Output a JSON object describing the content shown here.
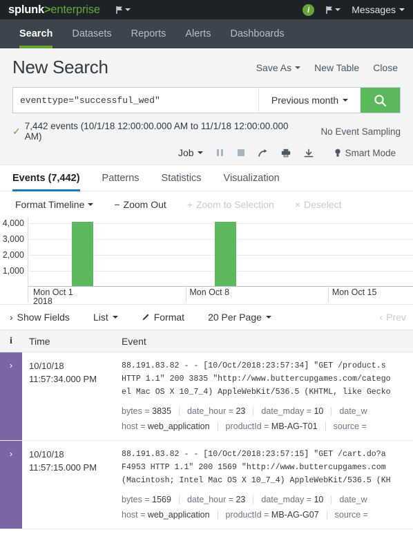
{
  "topbar": {
    "logo_splunk": "splunk",
    "logo_gt": ">",
    "logo_enterprise": "enterprise",
    "flag_icon": "flag-icon",
    "info_icon": "info-circle-icon",
    "info_label": "i",
    "messages_label": "Messages",
    "bg_color": "#1c2226",
    "accent_color": "#65a637"
  },
  "nav": {
    "items": [
      {
        "label": "Search",
        "active": true
      },
      {
        "label": "Datasets",
        "active": false
      },
      {
        "label": "Reports",
        "active": false
      },
      {
        "label": "Alerts",
        "active": false
      },
      {
        "label": "Dashboards",
        "active": false
      }
    ],
    "bg_color": "#3c444d",
    "active_underline_color": "#65a637"
  },
  "search_header": {
    "title": "New Search",
    "save_as_label": "Save As",
    "new_table_label": "New Table",
    "close_label": "Close",
    "query_value": "eventtype=\"successful_wed\"",
    "query_placeholder": "Search",
    "time_range_label": "Previous month",
    "search_icon": "magnifier-icon",
    "search_button_color": "#5cb85c"
  },
  "status": {
    "check_icon": "check-icon",
    "events_text": "7,442 events (10/1/18 12:00:00.000 AM to 11/1/18 12:00:00.000 AM)",
    "sampling_label": "No Event Sampling"
  },
  "job_toolbar": {
    "job_label": "Job",
    "pause_icon": "pause-icon",
    "stop_icon": "stop-icon",
    "share_icon": "share-arrow-icon",
    "print_icon": "printer-icon",
    "export_icon": "download-icon",
    "mode_icon": "lightbulb-icon",
    "mode_label": "Smart Mode"
  },
  "result_tabs": [
    {
      "label": "Events (7,442)",
      "active": true
    },
    {
      "label": "Patterns",
      "active": false
    },
    {
      "label": "Statistics",
      "active": false
    },
    {
      "label": "Visualization",
      "active": false
    }
  ],
  "timeline_toolbar": {
    "format_timeline_label": "Format Timeline",
    "zoom_out_label": "Zoom Out",
    "zoom_out_icon": "minus-icon",
    "zoom_selection_label": "Zoom to Selection",
    "zoom_selection_icon": "plus-icon",
    "deselect_label": "Deselect",
    "deselect_icon": "x-icon"
  },
  "chart_data": {
    "type": "bar",
    "title": "",
    "xlabel": "",
    "ylabel": "",
    "categories": [
      "Mon Oct 1 2018",
      "Mon Oct 8",
      "Mon Oct 15"
    ],
    "x_tick_labels": [
      {
        "line1": "Mon Oct 1",
        "line2": "2018",
        "left_pct": 3
      },
      {
        "line1": "Mon Oct 8",
        "line2": "",
        "left_pct": 41
      },
      {
        "line1": "Mon Oct 15",
        "line2": "",
        "left_pct": 78
      }
    ],
    "y_ticks": [
      "4,000",
      "3,000",
      "2,000",
      "1,000"
    ],
    "ylim": [
      0,
      4400
    ],
    "grid": true,
    "bar_color": "#5cb85c",
    "bars": [
      {
        "label": "Oct 3",
        "value": 4100,
        "left_pct": 11.5,
        "width_pct": 5.6
      },
      {
        "label": "Oct 10",
        "value": 4100,
        "left_pct": 48.5,
        "width_pct": 5.6
      }
    ]
  },
  "fields_toolbar": {
    "show_fields_label": "Show Fields",
    "show_fields_icon": "chevron-right-icon",
    "list_label": "List",
    "format_label": "Format",
    "format_icon": "pencil-icon",
    "per_page_label": "20 Per Page",
    "prev_label": "Prev",
    "prev_icon": "chevron-left-icon"
  },
  "events_table": {
    "columns": {
      "info": "i",
      "time": "Time",
      "event": "Event"
    },
    "rows": [
      {
        "expander_icon": "chevron-right-icon",
        "time_date": "10/10/18",
        "time_clock": "11:57:34.000 PM",
        "raw_lines": [
          "88.191.83.82 - - [10/Oct/2018:23:57:34] \"GET /product.s",
          "HTTP 1.1\" 200 3835 \"http://www.buttercupgames.com/catego",
          "el Mac OS X 10_7_4) AppleWebKit/536.5 (KHTML, like Gecko"
        ],
        "fields_line1": [
          {
            "key": "bytes",
            "value": "3835"
          },
          {
            "key": "date_hour",
            "value": "23"
          },
          {
            "key": "date_mday",
            "value": "10"
          },
          {
            "key": "date_w",
            "value": ""
          }
        ],
        "fields_line2": [
          {
            "key": "host",
            "value": "web_application"
          },
          {
            "key": "productId",
            "value": "MB-AG-T01"
          },
          {
            "key": "source",
            "value": ""
          }
        ]
      },
      {
        "expander_icon": "chevron-right-icon",
        "time_date": "10/10/18",
        "time_clock": "11:57:15.000 PM",
        "raw_lines": [
          "88.191.83.82 - - [10/Oct/2018:23:57:15] \"GET /cart.do?a",
          "F4953 HTTP 1.1\" 200 1569 \"http://www.buttercupgames.com",
          "(Macintosh; Intel Mac OS X 10_7_4) AppleWebKit/536.5 (KH"
        ],
        "fields_line1": [
          {
            "key": "bytes",
            "value": "1569"
          },
          {
            "key": "date_hour",
            "value": "23"
          },
          {
            "key": "date_mday",
            "value": "10"
          },
          {
            "key": "date_w",
            "value": ""
          }
        ],
        "fields_line2": [
          {
            "key": "host",
            "value": "web_application"
          },
          {
            "key": "productId",
            "value": "MB-AG-G07"
          },
          {
            "key": "source",
            "value": ""
          }
        ]
      }
    ],
    "expander_color": "#7b65a4"
  }
}
